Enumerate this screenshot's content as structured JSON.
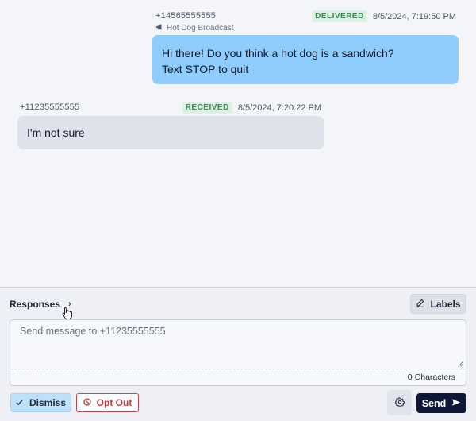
{
  "thread": {
    "outgoing": {
      "from": "+14565555555",
      "status": "DELIVERED",
      "timestamp": "8/5/2024, 7:19:50 PM",
      "broadcast": "Hot Dog Broadcast",
      "text_line1": "Hi there! Do you think a hot dog is a sandwich?",
      "text_line2": "Text STOP to quit"
    },
    "incoming": {
      "from": "+11235555555",
      "status": "RECEIVED",
      "timestamp": "8/5/2024, 7:20:22 PM",
      "text": "I'm not sure"
    }
  },
  "composer": {
    "responses_label": "Responses",
    "labels_button": "Labels",
    "placeholder": "Send message to +11235555555",
    "char_count": "0",
    "char_label": "Characters",
    "dismiss_label": "Dismiss",
    "opt_out_label": "Opt Out",
    "send_label": "Send"
  },
  "colors": {
    "outgoing_bubble": "#8ecdfd",
    "incoming_bubble": "#dfe2ea",
    "status_badge": "#dcf1e3",
    "send_button": "#0e1736",
    "opt_out_border": "#b94b4b"
  }
}
